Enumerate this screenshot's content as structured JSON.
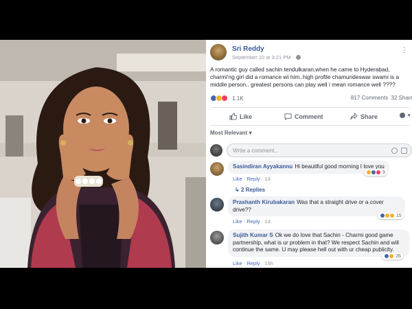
{
  "post": {
    "author": "Sri Reddy",
    "timestamp": "September 10 at 3:21 PM ·",
    "text_lines": [
      "A romantic guy called sachin tendulkaran,when he came to Hyderabad,",
      "charmi'ng girl did a romance wt him..high profile chamundeswar swami is a",
      "middle person.. greatest persons can play well i mean romance well ????"
    ],
    "reaction_count": "1.1K",
    "comments_count": "817 Comments",
    "shares_count": "32 Share",
    "actions": {
      "like": "Like",
      "comment": "Comment",
      "share": "Share"
    },
    "sort_label": "Most Relevant ▾",
    "composer_placeholder": "Write a comment..."
  },
  "comments": [
    {
      "name": "Sasindiran Ayyakannu",
      "lines": [
        "Hi beautiful good morning I love you"
      ],
      "like": "Like",
      "reply": "Reply",
      "time": "1d",
      "reaction_count": "9",
      "replies": "2 Replies"
    },
    {
      "name": "Prashanth Kirubakaran",
      "lines": [
        "Was that a straight drive or a cover",
        "drive??"
      ],
      "like": "Like",
      "reply": "Reply",
      "time": "1d",
      "reaction_count": "15"
    },
    {
      "name": "Sujith Kumar S",
      "lines": [
        "Ok we do love that Sachin - Charmi good game",
        "partnership, what is ur problem in that? We respect Sachin and will",
        "continue the same. U may please hell out with ur cheap publicity."
      ],
      "like": "Like",
      "reply": "Reply",
      "time": "15h",
      "reaction_count": "26"
    }
  ],
  "colors": {
    "link_blue": "#385898",
    "facebook_blue": "#4267b2",
    "gray_text": "#606770",
    "bubble_bg": "#f2f3f5"
  }
}
